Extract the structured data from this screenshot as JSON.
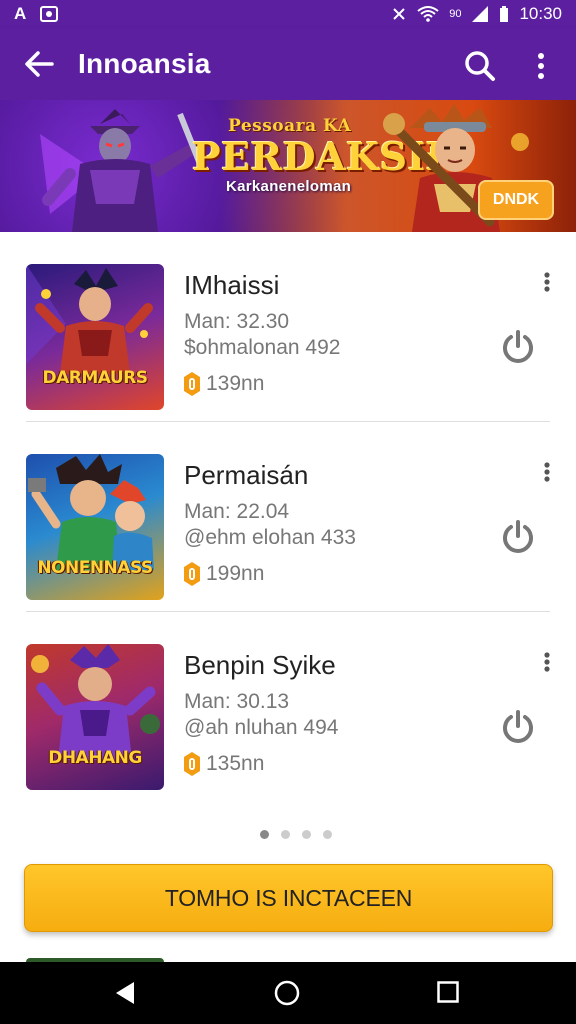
{
  "status_bar": {
    "carrier_icon": "A",
    "time": "10:30",
    "signal_text": "90"
  },
  "app_bar": {
    "title": "Innoansia"
  },
  "banner": {
    "subtitle": "Pessoara KA",
    "title": "PERDAKSH",
    "tagline": "Karkaneneloman",
    "cta": "DNDK"
  },
  "games": [
    {
      "name": "IMhaissi",
      "meta1": "Man: 32.30",
      "meta2": "$ohmalonan 492",
      "badge": "139nn",
      "thumb_label": "DARMAURS",
      "colors": {
        "bg_top": "#2a1a7a",
        "bg_bottom": "#e0462a",
        "accent": "#c0392b"
      }
    },
    {
      "name": "Permaisán",
      "meta1": "Man: 22.04",
      "meta2": "@ehm elohan 433",
      "badge": "199nn",
      "thumb_label": "NONENNASS",
      "colors": {
        "bg_top": "#1e4fae",
        "bg_bottom": "#e2a21b",
        "accent": "#27ae60"
      }
    },
    {
      "name": "Benpin Syike",
      "meta1": "Man: 30.13",
      "meta2": "@ah nluhan 494",
      "badge": "135nn",
      "thumb_label": "DHAHANG",
      "colors": {
        "bg_top": "#c0392b",
        "bg_bottom": "#3a1a6e",
        "accent": "#7d3cc8"
      }
    }
  ],
  "pager": {
    "count": 4,
    "active": 0
  },
  "cta_button": {
    "label": "TOMHO IS INCTACEEN"
  },
  "theme": {
    "primary": "#5b1fa0",
    "cta": "#f6ad10",
    "badge": "#f39c12"
  },
  "icons": {
    "back": "arrow-left-icon",
    "search": "search-icon",
    "more": "more-vertical-icon",
    "action": "power-icon",
    "badge": "coin-icon"
  }
}
